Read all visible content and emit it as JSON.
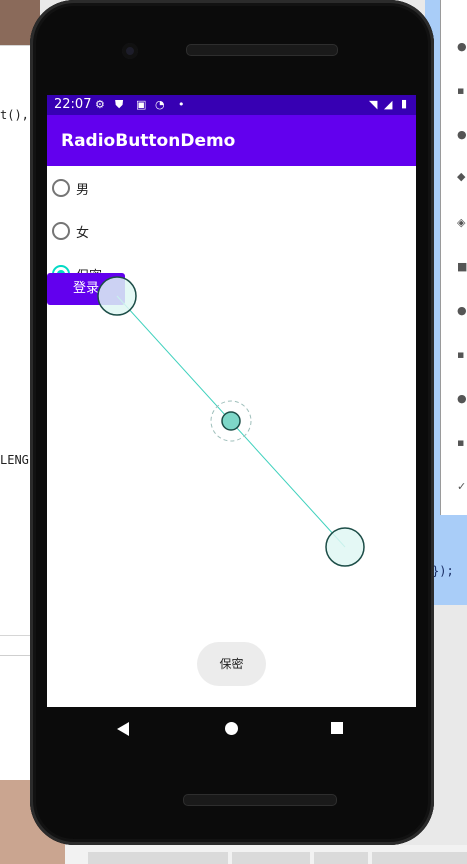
{
  "ide": {
    "left_code": [
      "t(),",
      "LENG"
    ],
    "right_code": "});"
  },
  "status_bar": {
    "time": "22:07",
    "icons": [
      "gear-icon",
      "shield-icon",
      "a-icon",
      "wifi-off-icon",
      "dot-icon",
      "wifi-icon",
      "signal-icon",
      "battery-icon"
    ]
  },
  "app": {
    "title": "RadioButtonDemo",
    "radios": [
      {
        "label": "男",
        "checked": false
      },
      {
        "label": "女",
        "checked": false
      },
      {
        "label": "保密",
        "checked": true
      }
    ],
    "login_label": "登录",
    "toast": "保密"
  },
  "colors": {
    "status_bar": "#3700b3",
    "app_bar": "#6200ee",
    "accent": "#03dac5",
    "button": "#6200ee"
  },
  "nav": [
    "back-icon",
    "home-icon",
    "recents-icon"
  ]
}
